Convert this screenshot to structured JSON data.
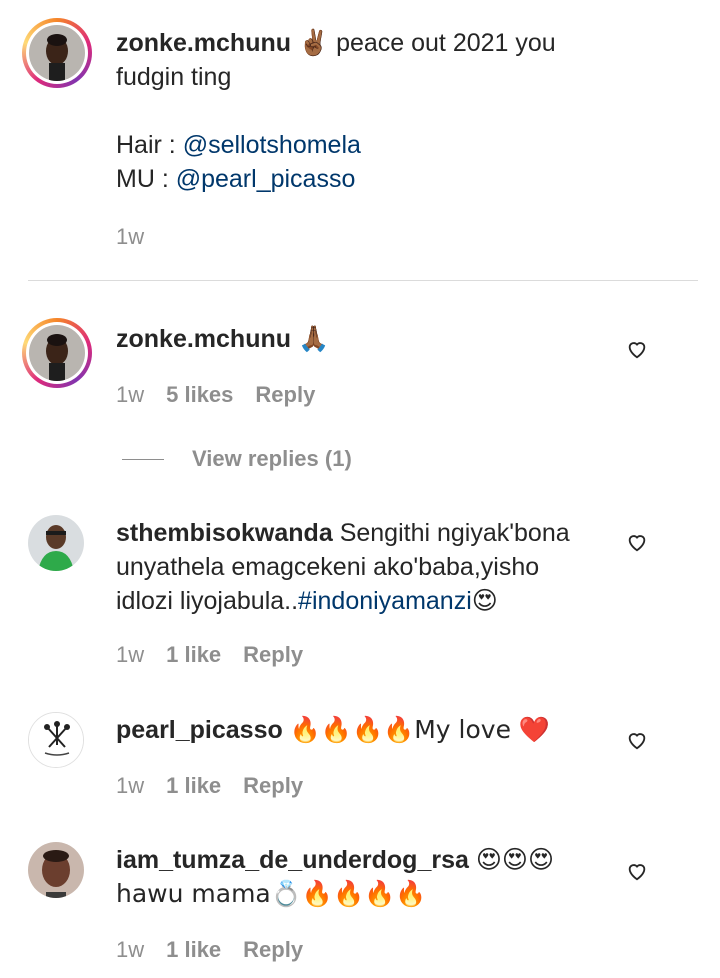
{
  "caption": {
    "username": "zonke.mchunu",
    "emoji": "✌🏾",
    "text_line1": "peace out 2021 you",
    "text_line2": "fudgin ting",
    "hair_label": "Hair : ",
    "hair_mention": "@sellotshomela",
    "mu_label": "MU : ",
    "mu_mention": "@pearl_picasso",
    "time": "1w"
  },
  "comments": [
    {
      "username": "zonke.mchunu",
      "text": "🙏🏾",
      "time": "1w",
      "likes": "5 likes",
      "reply": "Reply",
      "avatar_icon": "woman-portrait-avatar"
    },
    {
      "username": "sthembisokwanda",
      "text_line1": "Sengithi ngiyak'bona",
      "text_line2": "unyathela emagcekeni ako'baba,yisho",
      "text_line3_prefix": "idlozi liyojabula..",
      "hashtag": "#indoniyamanzi",
      "text_line3_suffix": "😍",
      "time": "1w",
      "likes": "1 like",
      "reply": "Reply",
      "avatar_icon": "man-green-shirt-avatar"
    },
    {
      "username": "pearl_picasso",
      "text": "🔥🔥🔥🔥My love ❤️",
      "time": "1w",
      "likes": "1 like",
      "reply": "Reply",
      "avatar_icon": "makeup-brush-logo-avatar"
    },
    {
      "username": "iam_tumza_de_underdog_rsa",
      "text_line1": "😍😍😍",
      "text_line2": "hawu mama💍🔥🔥🔥🔥",
      "time": "1w",
      "likes": "1 like",
      "reply": "Reply",
      "avatar_icon": "man-portrait-avatar"
    }
  ],
  "view_replies": "View replies (1)",
  "colors": {
    "link": "#00376b",
    "secondary": "#8e8e8e",
    "text": "#262626",
    "divider": "#dbdbdb"
  }
}
